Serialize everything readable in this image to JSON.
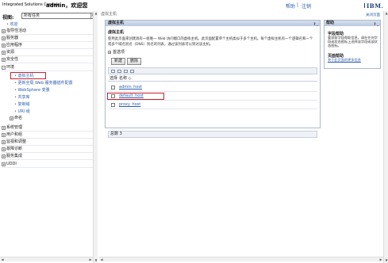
{
  "header": {
    "app_title": "Integrated Solutions Console",
    "welcome": "admin，欢迎您",
    "help": "帮助",
    "separator": "|",
    "logout": "注销",
    "logo": "IBM."
  },
  "sidebar": {
    "view_label": "视图:",
    "view_value": "所有任务",
    "welcome_link": "欢迎",
    "items": [
      {
        "label": "指导性活动",
        "expanded": false
      },
      {
        "label": "服务器",
        "expanded": false
      },
      {
        "label": "应用程序",
        "expanded": false
      },
      {
        "label": "资源",
        "expanded": false
      },
      {
        "label": "安全性",
        "expanded": false
      },
      {
        "label": "环境",
        "expanded": true
      },
      {
        "label": "系统管理",
        "expanded": false
      },
      {
        "label": "用户和组",
        "expanded": false
      },
      {
        "label": "监视和调整",
        "expanded": false
      },
      {
        "label": "故障诊断",
        "expanded": false
      },
      {
        "label": "服务集成",
        "expanded": false
      },
      {
        "label": "UDDI",
        "expanded": false
      }
    ],
    "env_children": [
      "虚拟主机",
      "更新全局 Web 服务器插件配置",
      "WebSphere 变量",
      "共享库",
      "复制域",
      "URI 组"
    ],
    "naming": "命名"
  },
  "main": {
    "breadcrumb": "虚拟主机",
    "panel_title": "虚拟主机",
    "panel_controls": "? _",
    "section_title": "虚拟主机",
    "description": "使用此页面来创建具有一组唯一 Web 访问端口的虚拟主机。此页面配置单个主机类似于多个主机。每个虚拟主机有一个逻辑名和一个或多个域名别名（DNS）别名的列表，通过该列表可以到达该主机。",
    "preferences": "首选项",
    "new_button": "新建",
    "delete_button": "删除",
    "table": {
      "col_select": "选择",
      "col_name": "名称 ◇",
      "rows": [
        "admin_host",
        "default_host",
        "proxy_host"
      ],
      "total": "总数 3"
    }
  },
  "help": {
    "title": "帮助",
    "controls": "? _",
    "close_page": "关闭页面",
    "field_help_title": "字段帮助",
    "field_help_text": "要获取字段帮助信息，请在任何字段或状态图标上选择该字段或该状态图标。",
    "page_help_title": "页面帮助",
    "page_help_link": "关于此页面的更多信息"
  },
  "colors": {
    "link": "#2a5db0",
    "highlight_box": "#c9232c",
    "panel_header": "#c6d3e6"
  }
}
